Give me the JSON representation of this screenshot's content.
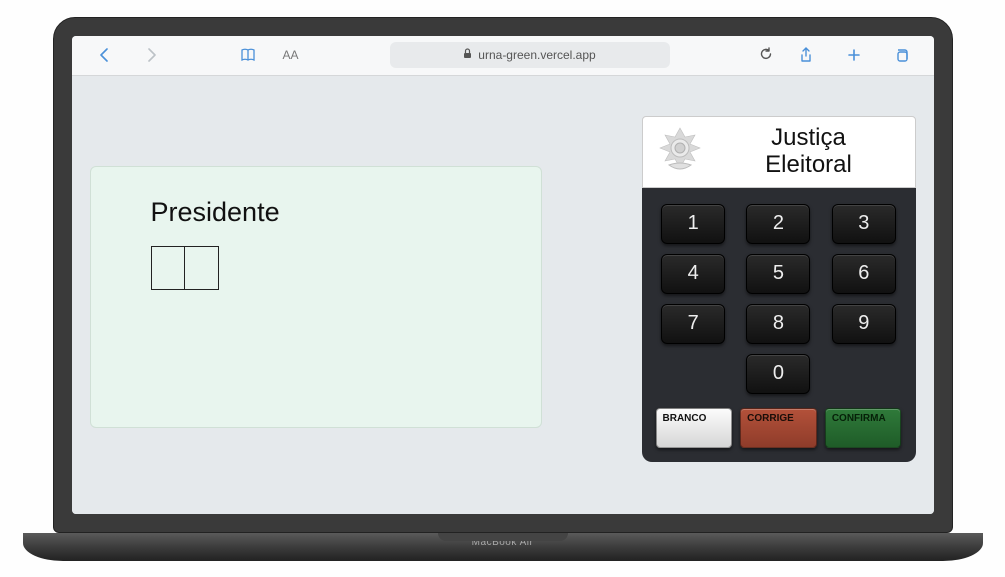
{
  "browser": {
    "url": "urna-green.vercel.app",
    "text_size_label": "AA"
  },
  "laptop": {
    "brand": "MacBook Air"
  },
  "vote_panel": {
    "office": "Presidente",
    "digit_count": 2,
    "digits": [
      "",
      ""
    ]
  },
  "urna": {
    "header_line1": "Justiça",
    "header_line2": "Eleitoral",
    "keys": [
      "1",
      "2",
      "3",
      "4",
      "5",
      "6",
      "7",
      "8",
      "9",
      "0"
    ],
    "actions": {
      "branco": "BRANCO",
      "corrige": "CORRIGE",
      "confirma": "CONFIRMA"
    }
  }
}
